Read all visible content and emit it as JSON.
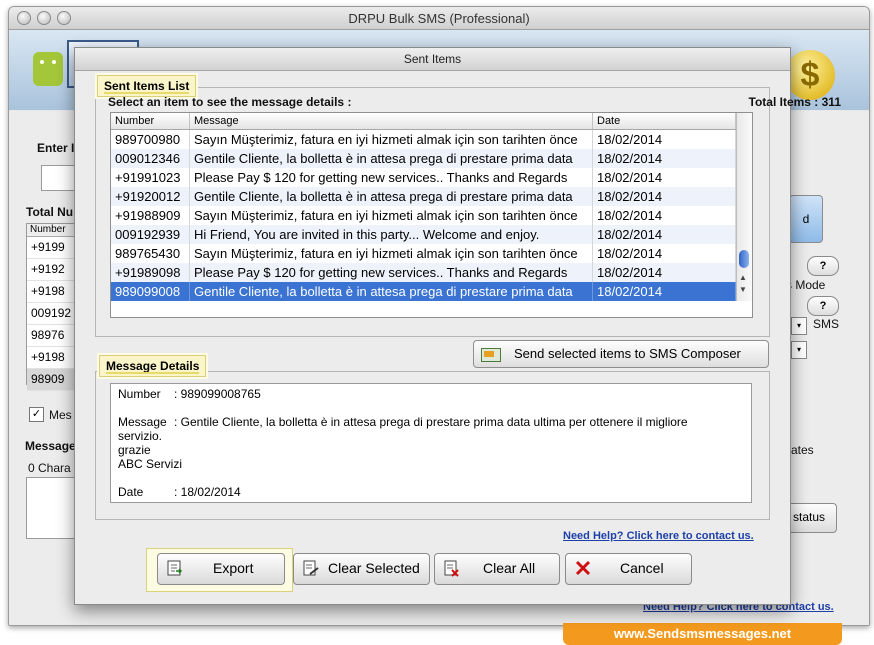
{
  "main_window": {
    "title": "DRPU Bulk SMS (Professional)",
    "labels": {
      "enter": "Enter I",
      "total_numbers": "Total Nu",
      "mini_header": "Number",
      "message_check": "Mes",
      "message_label": "Message",
      "char_count": "0 Chara",
      "sms_mode": "s Mode",
      "sms": "SMS",
      "templates": "ates",
      "status_button": "status",
      "d_button": "d",
      "q1": "?",
      "q2": "?"
    },
    "numbers": [
      "+9199",
      "+9192",
      "+9198",
      "009192",
      "98976",
      "+9198",
      "98909"
    ],
    "help_link": "Need Help? Click here to contact us."
  },
  "banner": "www.Sendsmsmessages.net",
  "dialog": {
    "title": "Sent Items",
    "list_group_title": "Sent Items List",
    "list_hint": "Select an item to see the message details :",
    "total_items": "Total Items : 311",
    "columns": [
      "Number",
      "Message",
      "Date"
    ],
    "rows": [
      {
        "number": "989700980",
        "message": "Sayın Müşterimiz, fatura en iyi hizmeti almak için son tarihten önce",
        "date": "18/02/2014"
      },
      {
        "number": "009012346",
        "message": "Gentile Cliente, la bolletta è in attesa prega di prestare prima data",
        "date": "18/02/2014"
      },
      {
        "number": "+91991023",
        "message": "Please Pay $ 120 for getting new services.. Thanks and Regards",
        "date": "18/02/2014"
      },
      {
        "number": "+91920012",
        "message": "Gentile Cliente, la bolletta è in attesa prega di prestare prima data",
        "date": "18/02/2014"
      },
      {
        "number": "+91988909",
        "message": "Sayın Müşterimiz, fatura en iyi hizmeti almak için son tarihten önce",
        "date": "18/02/2014"
      },
      {
        "number": "009192939",
        "message": "Hi Friend, You are invited in this party... Welcome and enjoy.",
        "date": "18/02/2014"
      },
      {
        "number": "989765430",
        "message": "Sayın Müşterimiz, fatura en iyi hizmeti almak için son tarihten önce",
        "date": "18/02/2014"
      },
      {
        "number": "+91989098",
        "message": "Please Pay $ 120 for getting new services.. Thanks and Regards",
        "date": "18/02/2014"
      },
      {
        "number": "989099008",
        "message": "Gentile Cliente, la bolletta è in attesa prega di prestare prima data",
        "date": "18/02/2014"
      }
    ],
    "selected_row_index": 8,
    "send_button": "Send selected items to SMS Composer",
    "details_group_title": "Message Details",
    "details": {
      "number_key": "Number",
      "number_value": ": 989099008765",
      "message_key": "Message",
      "message_value": ": Gentile Cliente, la bolletta è in attesa prega di prestare prima data ultima per ottenere il migliore",
      "message_line2": "servizio.",
      "message_line3": "grazie",
      "message_line4": "ABC Servizi",
      "date_key": "Date",
      "date_value": ": 18/02/2014"
    },
    "help_link": "Need Help? Click here to contact us.",
    "buttons": {
      "export": "Export",
      "clear_selected": "Clear Selected",
      "clear_all": "Clear All",
      "cancel": "Cancel"
    }
  },
  "colors": {
    "selection": "#3a73d1",
    "banner": "#f39a1e",
    "link": "#1d3fa8",
    "group_tag": "#fbf6c9"
  }
}
